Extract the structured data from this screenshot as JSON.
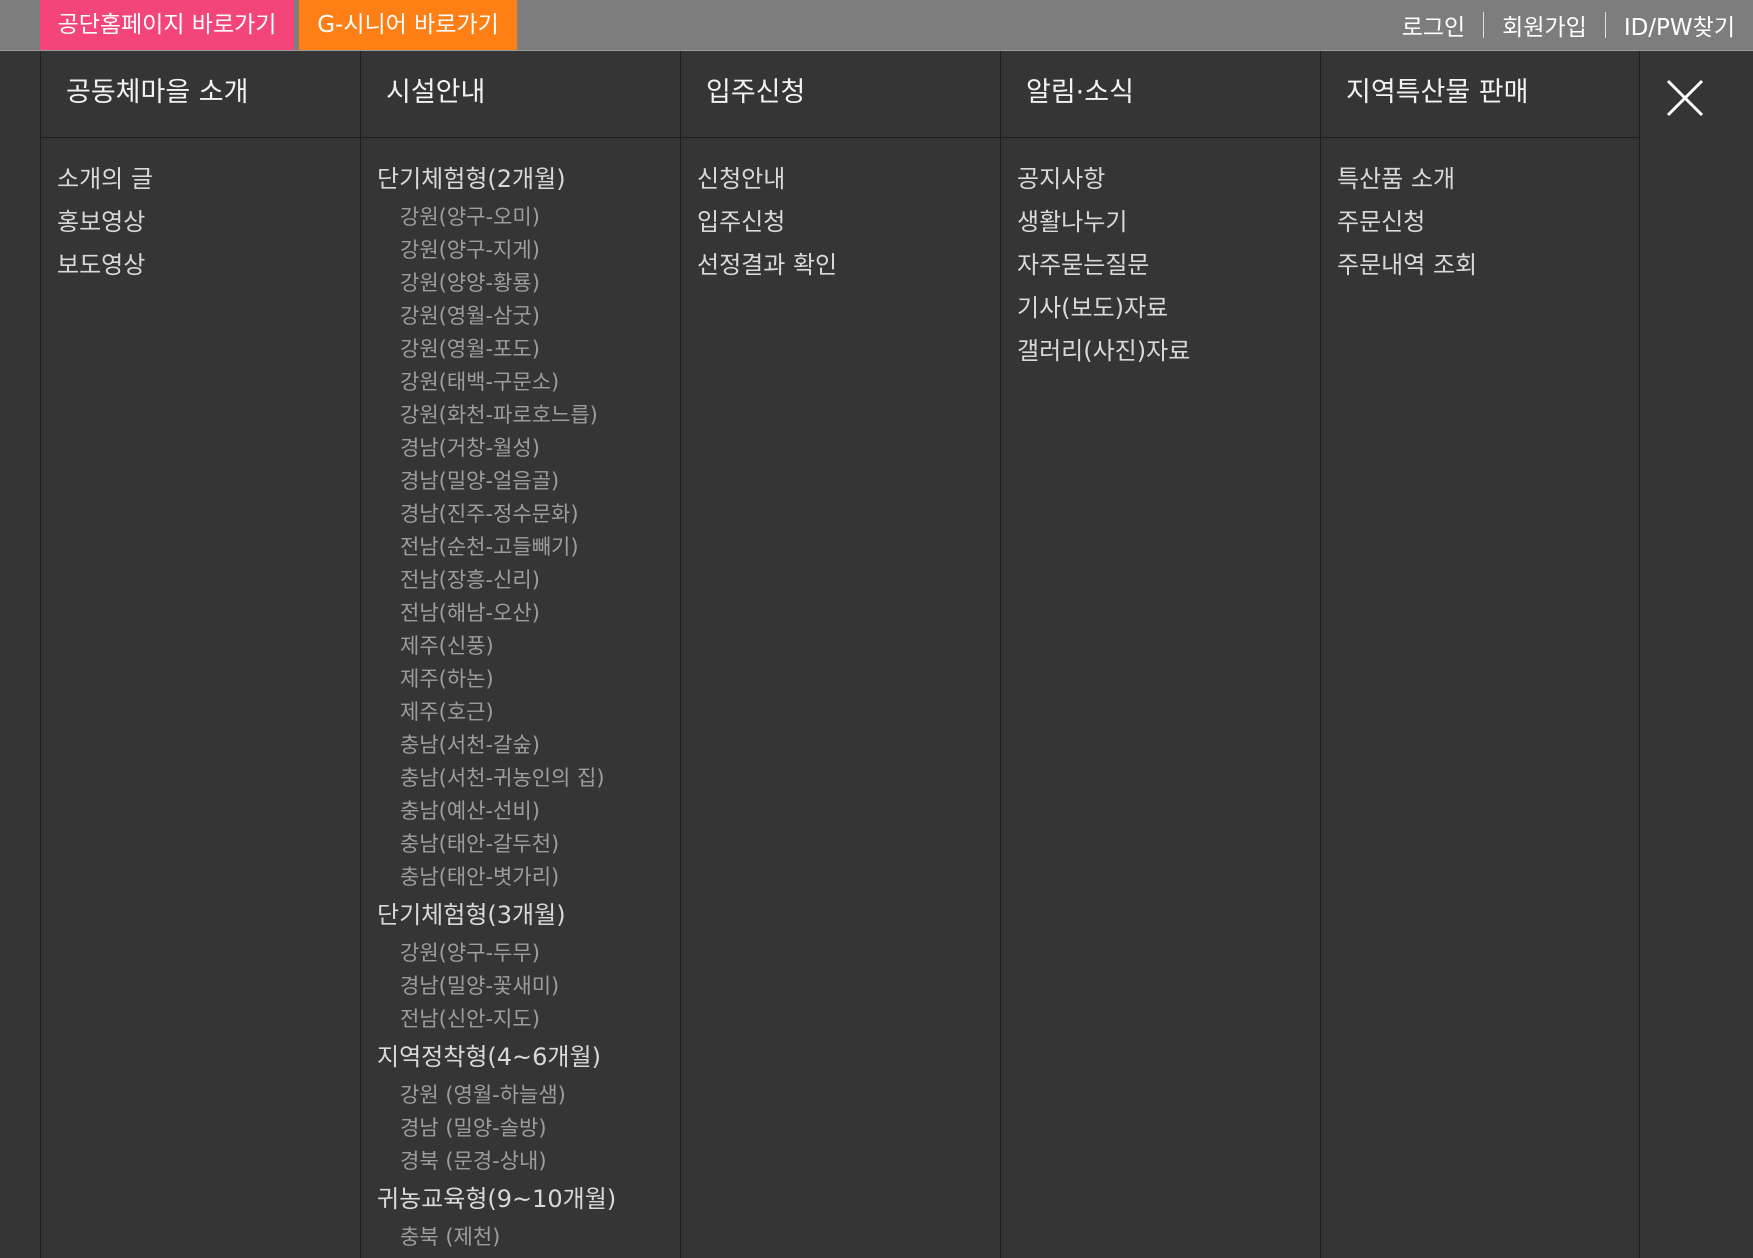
{
  "topbar": {
    "kc_label": "공단홈페이지 바로가기",
    "gsenior_label": "G-시니어 바로가기",
    "login": "로그인",
    "signup": "회원가입",
    "find": "ID/PW찾기",
    "kc_color": "#f4457b",
    "gsenior_color": "#ff7f17"
  },
  "close_icon": "close-icon",
  "columns": [
    {
      "title": "공동체마을 소개",
      "items": [
        {
          "label": "소개의 글",
          "subs": []
        },
        {
          "label": "홍보영상",
          "subs": []
        },
        {
          "label": "보도영상",
          "subs": []
        }
      ]
    },
    {
      "title": "시설안내",
      "items": [
        {
          "label": "단기체험형(2개월)",
          "subs": [
            "강원(양구-오미)",
            "강원(양구-지게)",
            "강원(양양-황룡)",
            "강원(영월-삼굿)",
            "강원(영월-포도)",
            "강원(태백-구문소)",
            "강원(화천-파로호느릅)",
            "경남(거창-월성)",
            "경남(밀양-얼음골)",
            "경남(진주-정수문화)",
            "전남(순천-고들빼기)",
            "전남(장흥-신리)",
            "전남(해남-오산)",
            "제주(신풍)",
            "제주(하논)",
            "제주(호근)",
            "충남(서천-갈숲)",
            "충남(서천-귀농인의 집)",
            "충남(예산-선비)",
            "충남(태안-갈두천)",
            "충남(태안-볏가리)"
          ]
        },
        {
          "label": "단기체험형(3개월)",
          "subs": [
            "강원(양구-두무)",
            "경남(밀양-꽃새미)",
            "전남(신안-지도)"
          ]
        },
        {
          "label": "지역정착형(4~6개월)",
          "subs": [
            "강원 (영월-하늘샘)",
            "경남 (밀양-솔방)",
            "경북 (문경-상내)"
          ]
        },
        {
          "label": "귀농교육형(9~10개월)",
          "subs": [
            "충북 (제천)"
          ]
        }
      ]
    },
    {
      "title": "입주신청",
      "items": [
        {
          "label": "신청안내",
          "subs": []
        },
        {
          "label": "입주신청",
          "subs": []
        },
        {
          "label": "선정결과 확인",
          "subs": []
        }
      ]
    },
    {
      "title": "알림·소식",
      "items": [
        {
          "label": "공지사항",
          "subs": []
        },
        {
          "label": "생활나누기",
          "subs": []
        },
        {
          "label": "자주묻는질문",
          "subs": []
        },
        {
          "label": "기사(보도)자료",
          "subs": []
        },
        {
          "label": "갤러리(사진)자료",
          "subs": []
        }
      ]
    },
    {
      "title": "지역특산물 판매",
      "items": [
        {
          "label": "특산품 소개",
          "subs": []
        },
        {
          "label": "주문신청",
          "subs": []
        },
        {
          "label": "주문내역 조회",
          "subs": []
        }
      ]
    }
  ]
}
